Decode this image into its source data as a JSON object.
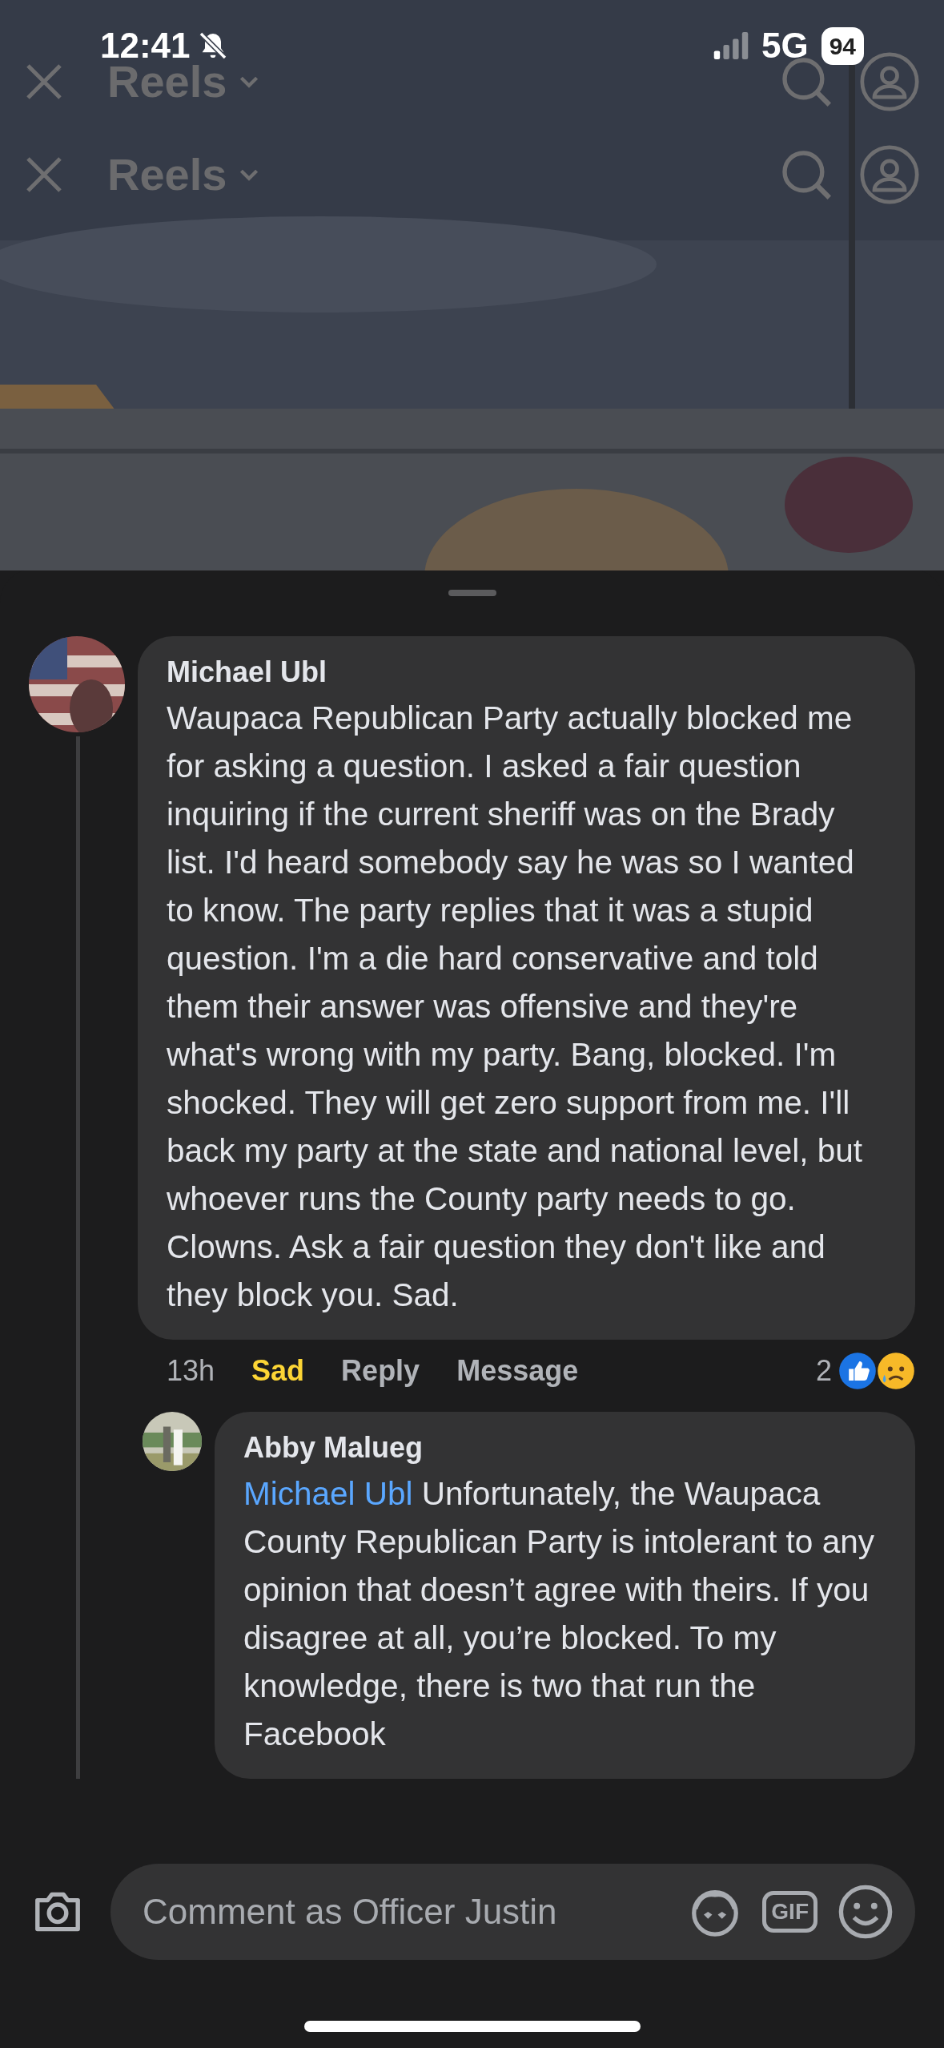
{
  "status_bar": {
    "time": "12:41",
    "network": "5G",
    "battery": "94"
  },
  "headers": [
    {
      "title": "Reels"
    },
    {
      "title": "Reels"
    }
  ],
  "comments": [
    {
      "author": "Michael Ubl",
      "text": "Waupaca Republican Party actually blocked me for asking a question.  I asked a fair question inquiring if the current sheriff was on the Brady list.  I'd heard somebody say he was so I wanted to know.  The party replies that it was a stupid question.  I'm a die hard conservative and told them their answer was offensive and they're what's wrong with my party.  Bang, blocked.  I'm shocked.  They will get zero support from me.  I'll back my party at the state and national level, but whoever runs the County party needs to go.  Clowns.  Ask a fair question they don't like and they block you.  Sad.",
      "time": "13h",
      "reaction_label": "Sad",
      "reacted": true,
      "actions": [
        "Reply",
        "Message"
      ],
      "reaction_count": "2",
      "replies": [
        {
          "author": "Abby Malueg",
          "mention": "Michael Ubl",
          "text": "Unfortunately, the Waupaca County Republican Party is intolerant to any opinion that doesn’t agree with theirs. If you disagree at all, you’re blocked. To my knowledge, there is two that run the Facebook"
        }
      ]
    }
  ],
  "composer": {
    "placeholder": "Comment as Officer Justin",
    "gif_label": "GIF"
  }
}
